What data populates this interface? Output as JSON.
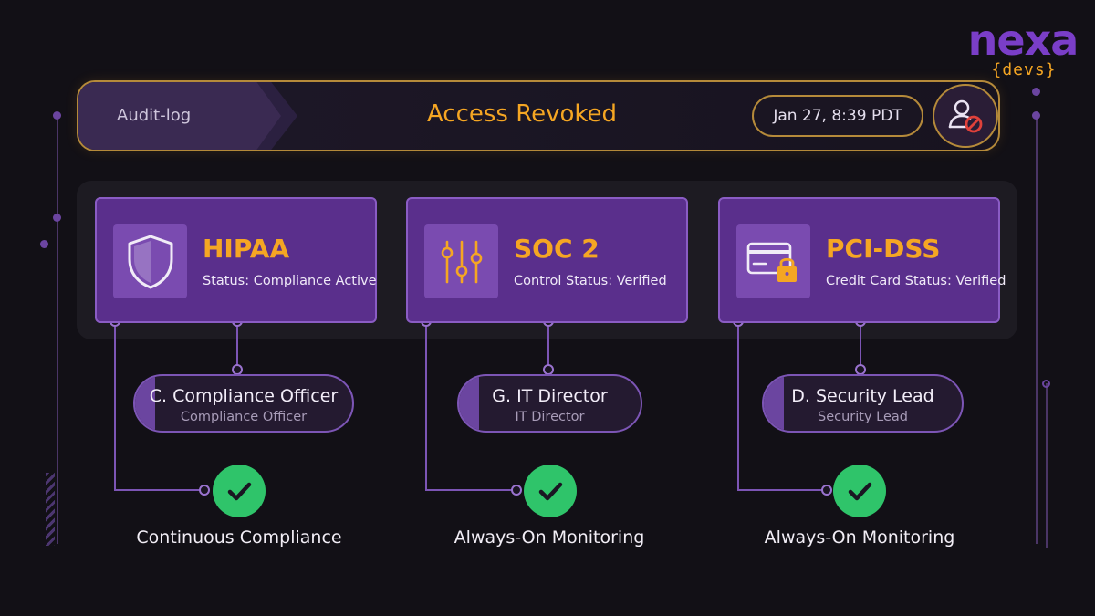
{
  "logo": {
    "name": "nexa",
    "sub": "{devs}"
  },
  "header": {
    "breadcrumb": "Audit-log",
    "title": "Access Revoked",
    "timestamp": "Jan 27, 8:39 PDT",
    "user_action_icon": "user-blocked-icon"
  },
  "colors": {
    "accent": "#f5a623",
    "card": "#5a2f8c",
    "success": "#2fc46a",
    "background": "#121016"
  },
  "compliance": [
    {
      "title": "HIPAA",
      "status": "Status: Compliance Active",
      "icon": "shield-icon",
      "owner": {
        "name": "C. Compliance Officer",
        "role": "Compliance Officer"
      },
      "result": "Continuous Compliance"
    },
    {
      "title": "SOC 2",
      "status": "Control Status: Verified",
      "icon": "sliders-icon",
      "owner": {
        "name": "G. IT Director",
        "role": "IT Director"
      },
      "result": "Always-On Monitoring"
    },
    {
      "title": "PCI-DSS",
      "status": "Credit Card Status: Verified",
      "icon": "credit-card-lock-icon",
      "owner": {
        "name": "D. Security Lead",
        "role": "Security Lead"
      },
      "result": "Always-On Monitoring"
    }
  ]
}
